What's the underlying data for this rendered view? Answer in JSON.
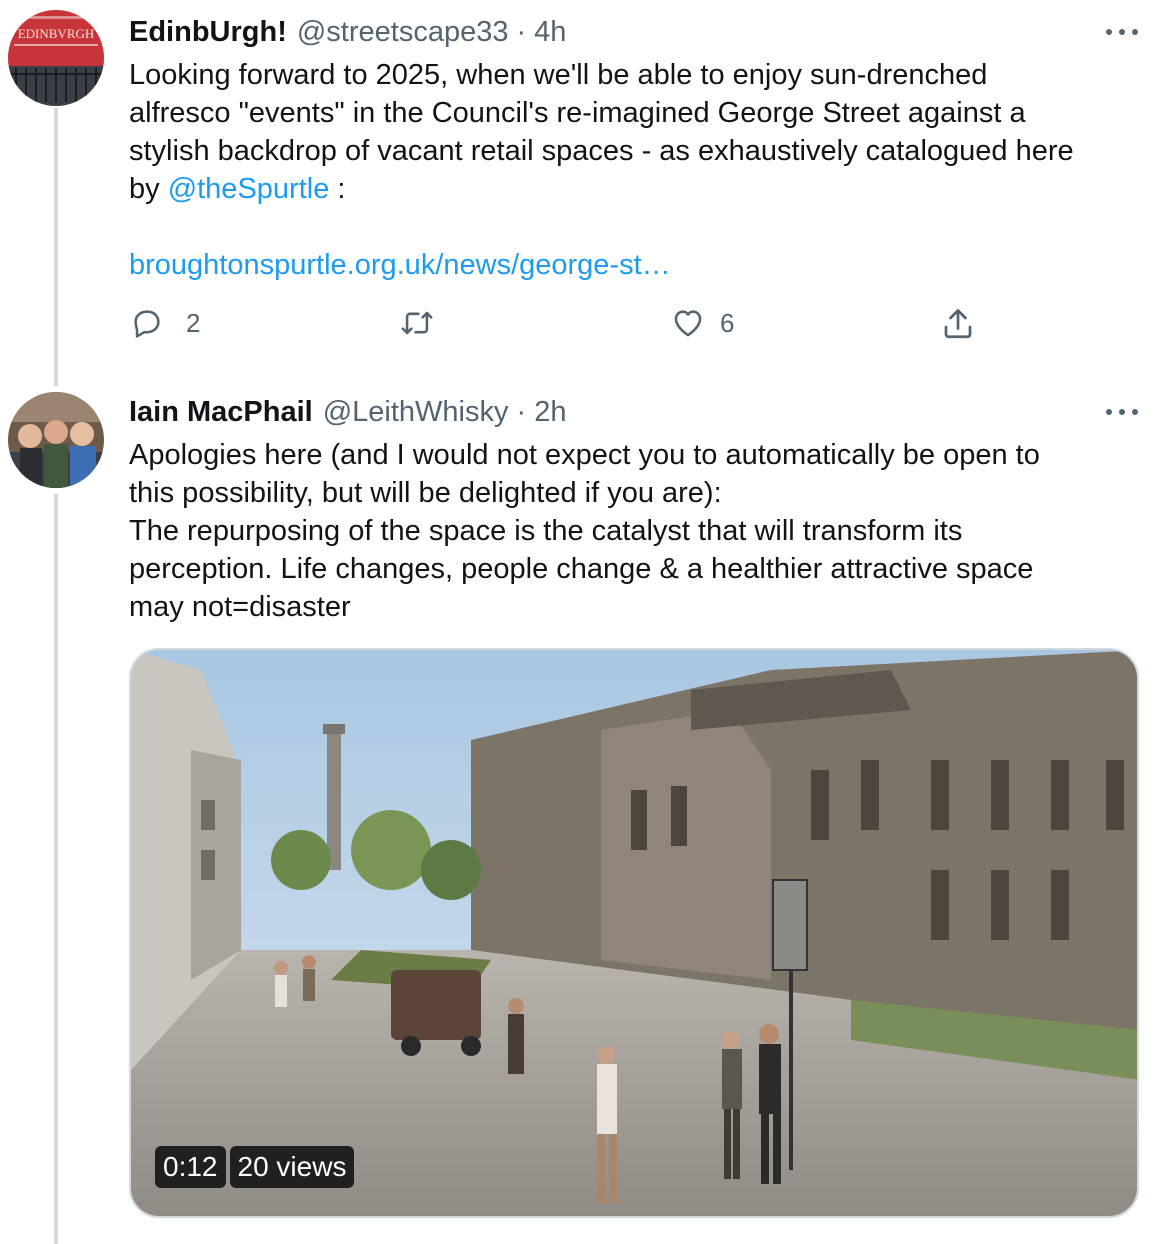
{
  "tweets": [
    {
      "name": "EdinbUrgh!",
      "handle": "@streetscape33",
      "separator": "·",
      "time": "4h",
      "avatar_text": "EDINBVRGH",
      "text_before": "Looking forward to 2025, when we'll be able to enjoy sun-drenched\nalfresco \"events\" in the Council's re-imagined George Street against a\nstylish backdrop of vacant retail spaces - as exhaustively catalogued here\nby ",
      "mention": "@theSpurtle",
      "text_after": " :",
      "link": "broughtonspurtle.org.uk/news/george-st…",
      "replies": "2",
      "likes": "6"
    },
    {
      "name": "Iain MacPhail",
      "handle": "@LeithWhisky",
      "separator": "·",
      "time": "2h",
      "text": "Apologies here (and I would not expect you to automatically be open to\nthis possibility, but will be delighted if you are):\nThe repurposing of the space is the catalyst that will transform its\nperception. Life changes, people change & a healthier attractive space\nmay not=disaster",
      "video": {
        "duration": "0:12",
        "views": "20 views"
      }
    }
  ],
  "colors": {
    "link": "#1d9bf0",
    "muted": "#536471",
    "thread_line": "#cfd9de"
  },
  "icons": [
    "reply-icon",
    "retweet-icon",
    "like-icon",
    "share-icon",
    "more-icon"
  ]
}
